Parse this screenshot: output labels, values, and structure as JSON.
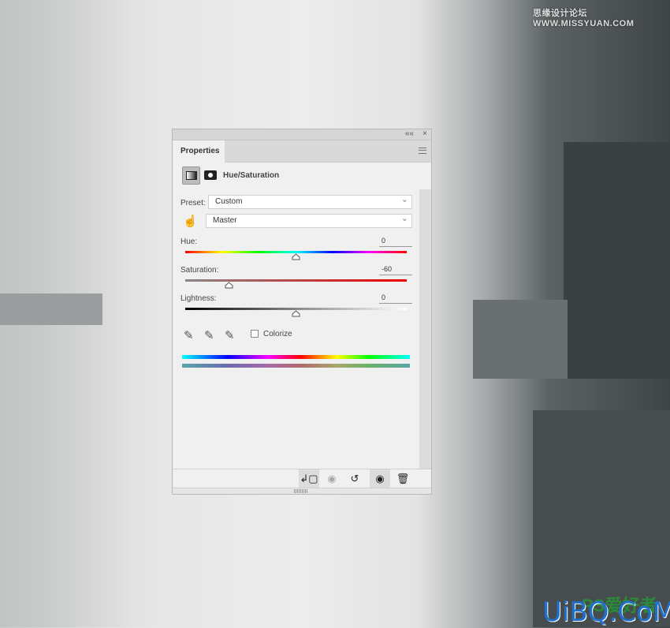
{
  "panel": {
    "tab": "Properties",
    "title": "Hue/Saturation",
    "preset_label": "Preset:",
    "preset_value": "Custom",
    "channel_value": "Master",
    "hue": {
      "label": "Hue:",
      "value": "0"
    },
    "saturation": {
      "label": "Saturation:",
      "value": "-60"
    },
    "lightness": {
      "label": "Lightness:",
      "value": "0"
    },
    "colorize_label": "Colorize",
    "colorize_checked": false,
    "collapse_icon": "««",
    "close_icon": "×"
  },
  "watermarks": {
    "top": "思缘设计论坛 WWW.MISSYUAN.COM",
    "bottom": "UiBQ.CoM",
    "bottom_logo": "PS爱好者"
  }
}
